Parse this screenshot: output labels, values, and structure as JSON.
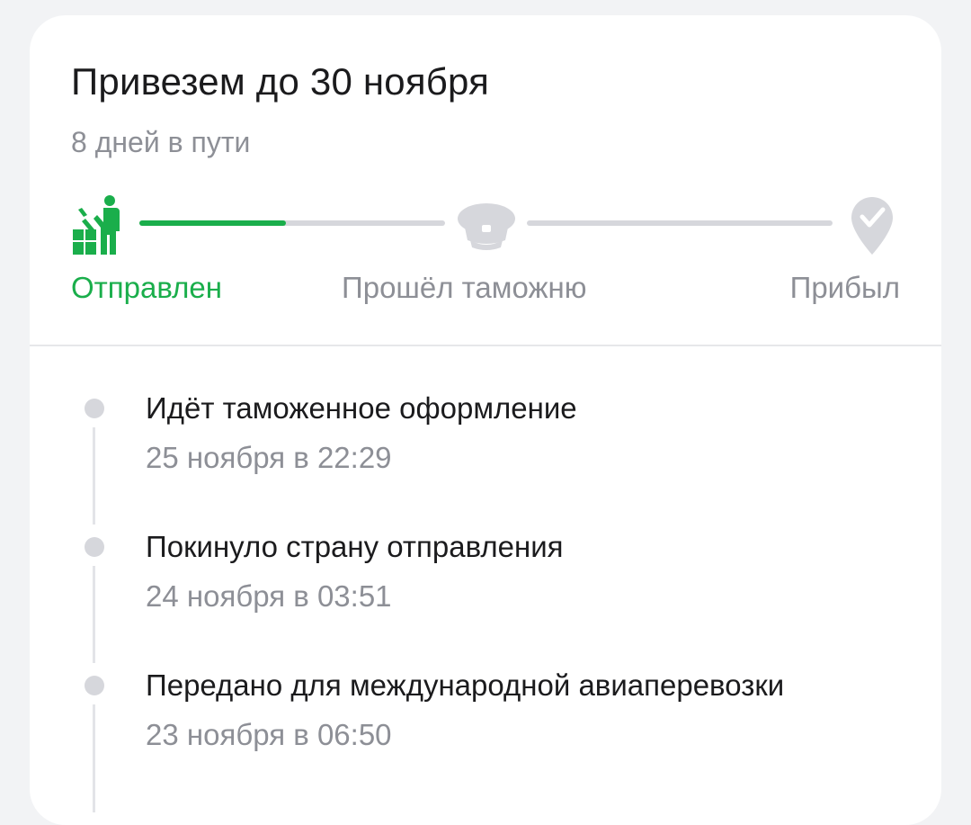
{
  "delivery": {
    "title": "Привезем до 30 ноября",
    "subtitle": "8 дней в пути"
  },
  "progress": {
    "stages": [
      {
        "label": "Отправлен",
        "icon": "loader-worker-icon",
        "status": "done"
      },
      {
        "label": "Прошёл таможню",
        "icon": "customs-cap-icon",
        "status": "pending"
      },
      {
        "label": "Прибыл",
        "icon": "location-check-icon",
        "status": "pending"
      }
    ],
    "segment_1_fill": 0.48,
    "segment_2_fill": 0.0,
    "colors": {
      "active": "#1aae4b",
      "inactive": "#d6d7dc"
    }
  },
  "events": [
    {
      "title": "Идёт таможенное оформление",
      "time": "25 ноября в 22:29"
    },
    {
      "title": "Покинуло страну отправления",
      "time": "24 ноября в 03:51"
    },
    {
      "title": "Передано для международной авиаперевозки",
      "time": "23 ноября в 06:50"
    }
  ]
}
